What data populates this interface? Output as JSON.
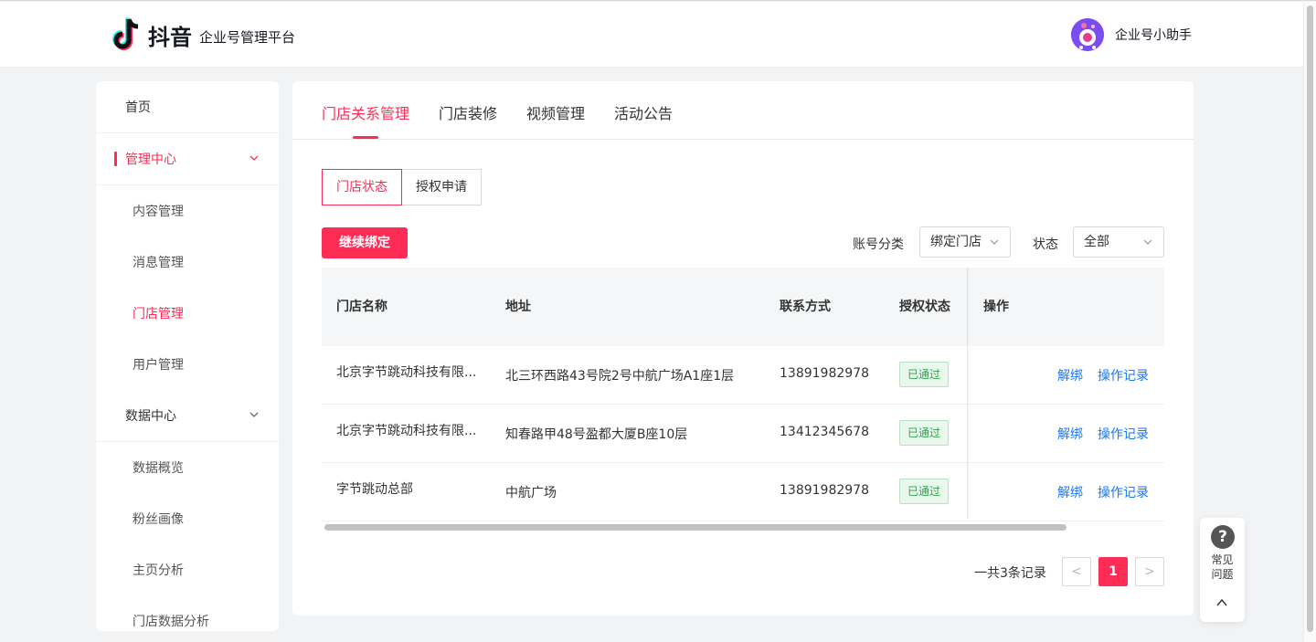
{
  "header": {
    "logo_text": "抖音",
    "platform_title": "企业号管理平台",
    "user_name": "企业号小助手"
  },
  "sidebar": {
    "items": [
      {
        "label": "首页"
      },
      {
        "label": "管理中心"
      },
      {
        "label": "内容管理"
      },
      {
        "label": "消息管理"
      },
      {
        "label": "门店管理"
      },
      {
        "label": "用户管理"
      },
      {
        "label": "数据中心"
      },
      {
        "label": "数据概览"
      },
      {
        "label": "粉丝画像"
      },
      {
        "label": "主页分析"
      },
      {
        "label": "门店数据分析"
      }
    ],
    "active_item": "门店管理",
    "expanded_group": "管理中心"
  },
  "main": {
    "tabs": [
      {
        "label": "门店关系管理"
      },
      {
        "label": "门店装修"
      },
      {
        "label": "视频管理"
      },
      {
        "label": "活动公告"
      }
    ],
    "active_tab": "门店关系管理",
    "segments": [
      {
        "label": "门店状态"
      },
      {
        "label": "授权申请"
      }
    ],
    "active_segment": "门店状态",
    "primary_button": "继续绑定",
    "filters": {
      "account_label": "账号分类",
      "account_value": "绑定门店",
      "status_label": "状态",
      "status_value": "全部"
    },
    "table": {
      "columns": [
        "门店名称",
        "地址",
        "联系方式",
        "授权状态",
        "操作"
      ],
      "rows": [
        {
          "name": "北京字节跳动科技有限...",
          "address": "北三环西路43号院2号中航广场A1座1层",
          "phone": "13891982978",
          "status": "已通过",
          "action1": "解绑",
          "action2": "操作记录"
        },
        {
          "name": "北京字节跳动科技有限...",
          "address": "知春路甲48号盈都大厦B座10层",
          "phone": "13412345678",
          "status": "已通过",
          "action1": "解绑",
          "action2": "操作记录"
        },
        {
          "name": "字节跳动总部",
          "address": "中航广场",
          "phone": "13891982978",
          "status": "已通过",
          "action1": "解绑",
          "action2": "操作记录"
        }
      ]
    },
    "pagination": {
      "total_text": "一共3条记录",
      "current_page": "1",
      "prev_symbol": "<",
      "next_symbol": ">"
    }
  },
  "faq": {
    "icon_symbol": "?",
    "line1": "常见",
    "line2": "问题"
  },
  "colors": {
    "brand": "#fe2c55",
    "link": "#1677ff",
    "success": "#2aa44f"
  }
}
